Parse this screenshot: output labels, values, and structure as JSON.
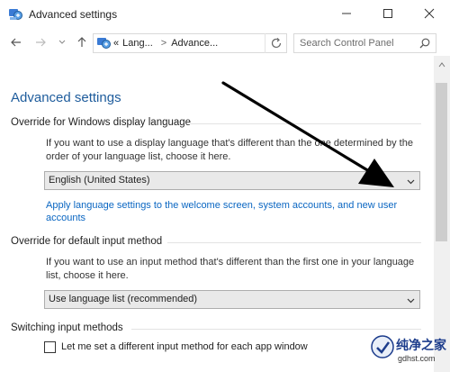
{
  "window": {
    "title": "Advanced settings",
    "controls": {
      "minimize": "minimize",
      "maximize": "maximize",
      "close": "close"
    }
  },
  "nav": {
    "address": {
      "overflow": "«",
      "crumb1": "Lang...",
      "separator": ">",
      "crumb2": "Advance..."
    },
    "search_placeholder": "Search Control Panel"
  },
  "content": {
    "page_title": "Advanced settings",
    "display_language": {
      "heading": "Override for Windows display language",
      "description": "If you want to use a display language that's different than the one determined by the order of your language list, choose it here.",
      "selected": "English (United States)",
      "link": "Apply language settings to the welcome screen, system accounts, and new user accounts"
    },
    "input_method": {
      "heading": "Override for default input method",
      "description": "If you want to use an input method that's different than the first one in your language list, choose it here.",
      "selected": "Use language list (recommended)"
    },
    "switching": {
      "heading": "Switching input methods",
      "checkbox_label": "Let me set a different input method for each app window",
      "checked": false
    }
  },
  "watermark": {
    "title": "纯净之家",
    "url": "gdhst.com"
  },
  "colors": {
    "title_blue": "#1e5c9c",
    "link_blue": "#0a66c2",
    "arrow": "#000000"
  }
}
